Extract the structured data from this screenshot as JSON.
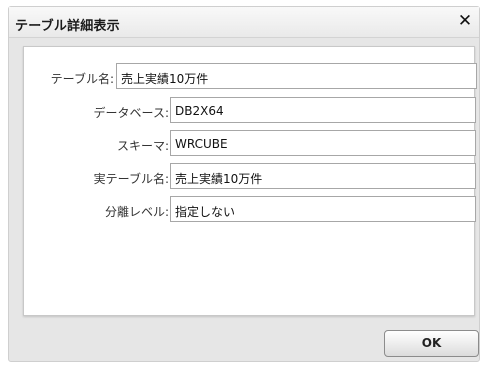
{
  "dialog": {
    "title": "テーブル詳細表示",
    "close_label": "✕",
    "ok_label": "OK"
  },
  "fields": [
    {
      "label": "テーブル名:",
      "value": "売上実績10万件"
    },
    {
      "label": "データベース:",
      "value": "DB2X64"
    },
    {
      "label": "スキーマ:",
      "value": "WRCUBE"
    },
    {
      "label": "実テーブル名:",
      "value": "売上実績10万件"
    },
    {
      "label": "分離レベル:",
      "value": "指定しない"
    }
  ]
}
